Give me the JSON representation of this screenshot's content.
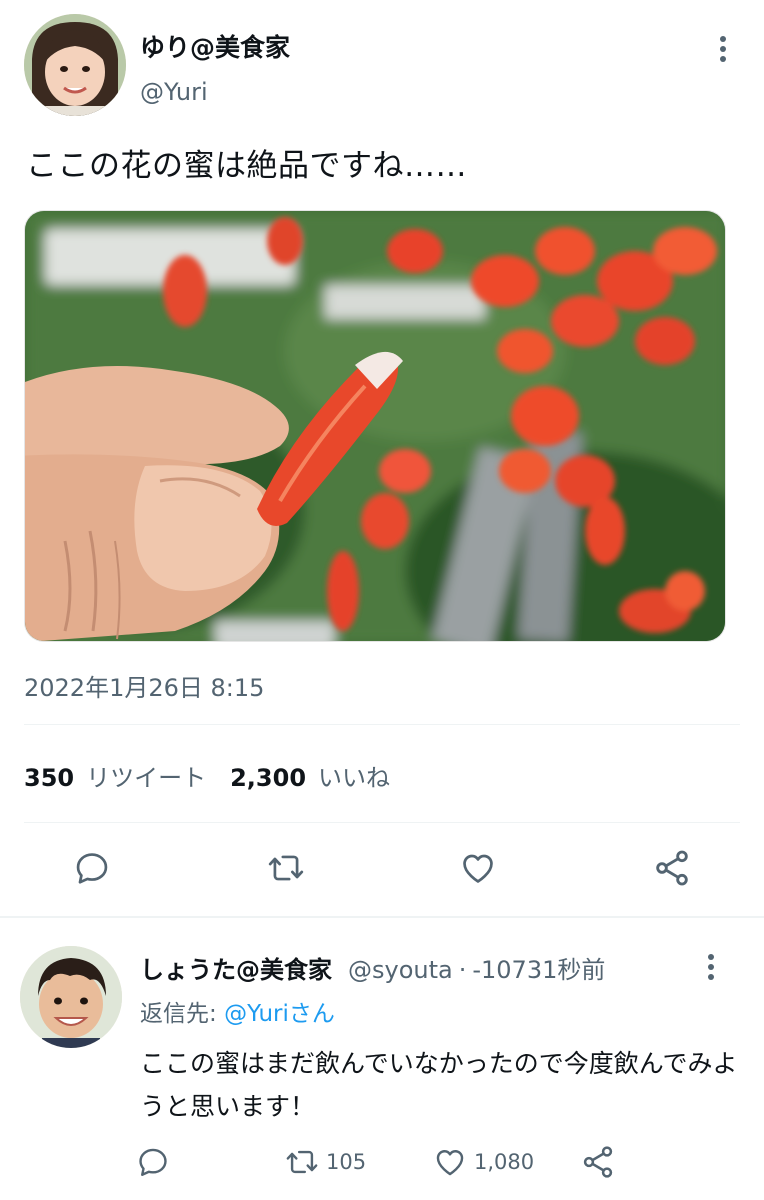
{
  "tweet": {
    "display_name": "ゆり@美食家",
    "handle": "@Yuri",
    "text": "ここの花の蜜は絶品ですね……",
    "timestamp": "2022年1月26日 8:15",
    "retweet_count": "350",
    "retweet_label": "リツイート",
    "like_count": "2,300",
    "like_label": "いいね",
    "actions": [
      "reply-icon",
      "retweet-icon",
      "like-icon",
      "share-icon"
    ]
  },
  "reply": {
    "display_name": "しょうた@美食家",
    "handle": "@syouta",
    "separator": "·",
    "time": "-10731秒前",
    "reply_to_prefix": "返信先: ",
    "reply_to_user": "@Yuriさん",
    "text": "ここの蜜はまだ飲んでいなかったので今度飲んでみようと思います！",
    "reply_count": "",
    "retweet_count": "105",
    "like_count": "1,080"
  },
  "colors": {
    "text_primary": "#0f1419",
    "text_secondary": "#536471",
    "accent": "#1d9bf0",
    "divider": "#eff3f4"
  }
}
